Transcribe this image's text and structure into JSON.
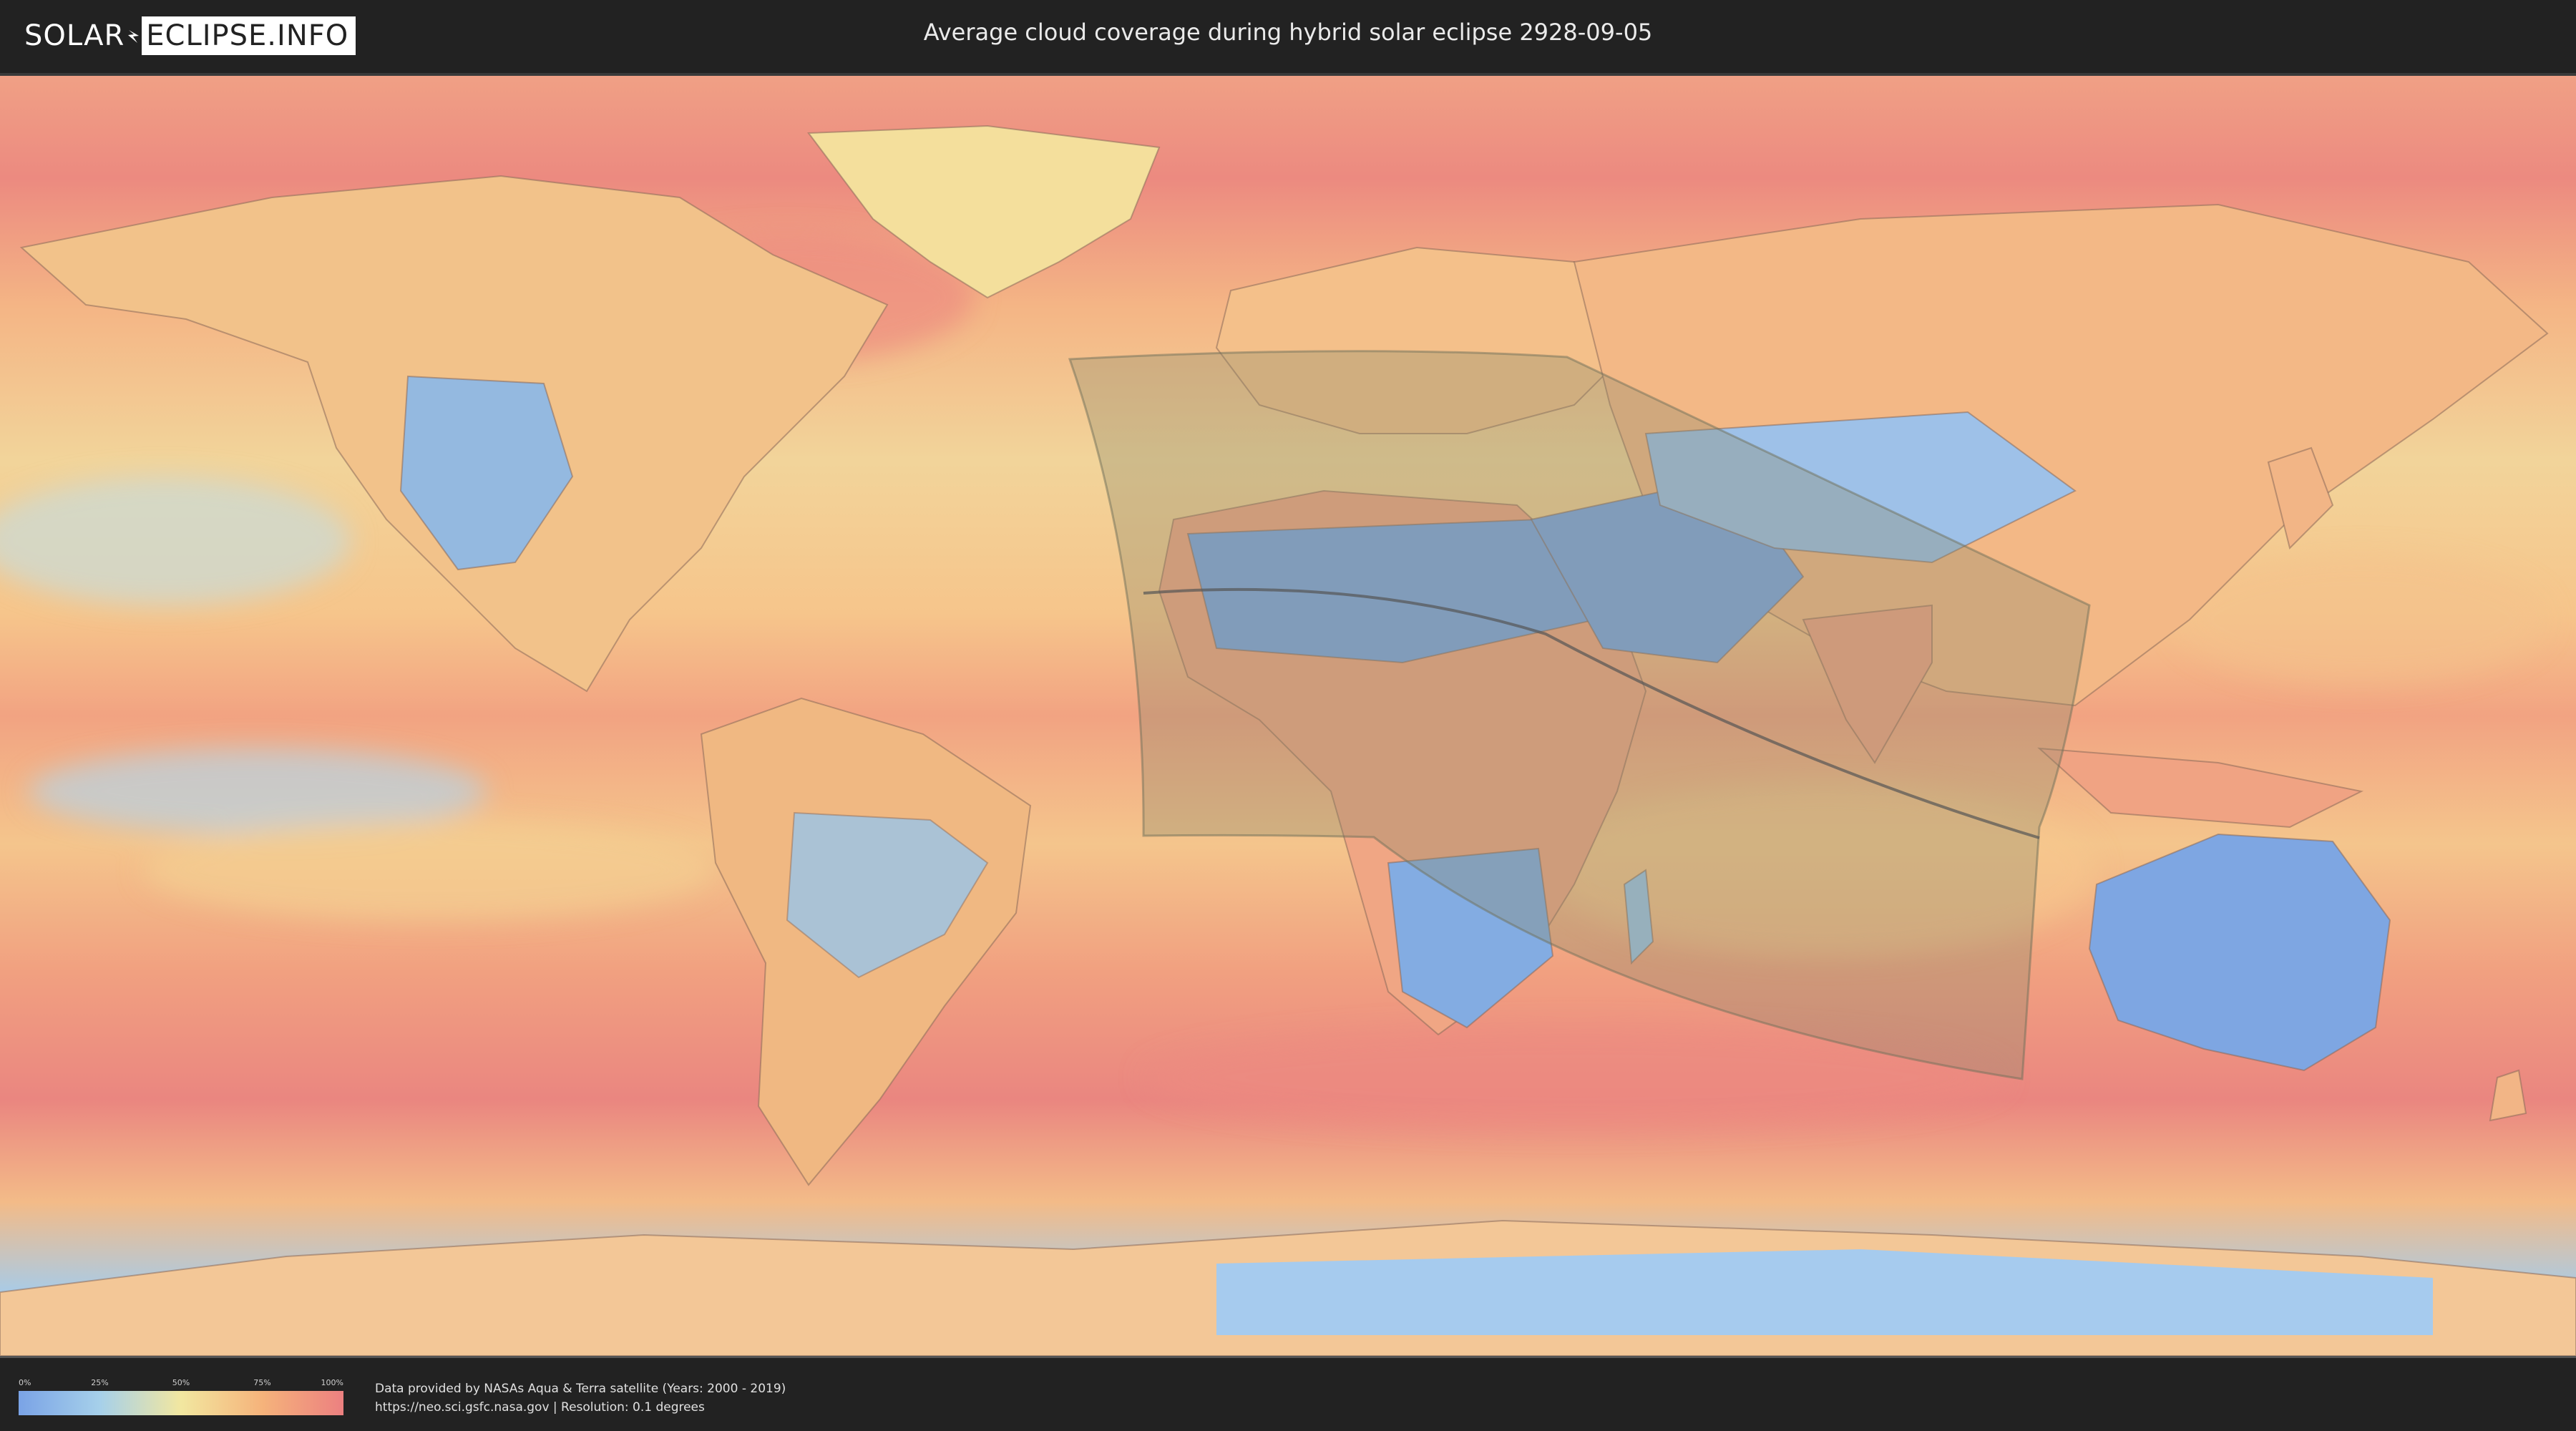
{
  "header": {
    "logo_part1": "SOLAR",
    "logo_part2": "ECLIPSE.INFO",
    "title": "Average cloud coverage during hybrid solar eclipse 2928-09-05"
  },
  "legend": {
    "ticks": [
      "0%",
      "25%",
      "50%",
      "75%",
      "100%"
    ],
    "colors": [
      "#7aa3e6",
      "#a6d0ea",
      "#f2e7a0",
      "#f5b37b",
      "#ec8080"
    ]
  },
  "footer": {
    "credit_line1": "Data provided by NASAs Aqua & Terra satellite (Years: 2000 - 2019)",
    "credit_line2": "https://neo.sci.gsfc.nasa.gov | Resolution: 0.1 degrees"
  },
  "map": {
    "projection": "equirectangular",
    "layer": "cloud coverage",
    "eclipse_visibility_zone_color": "#8a8a6a",
    "central_line_color": "#555555"
  }
}
